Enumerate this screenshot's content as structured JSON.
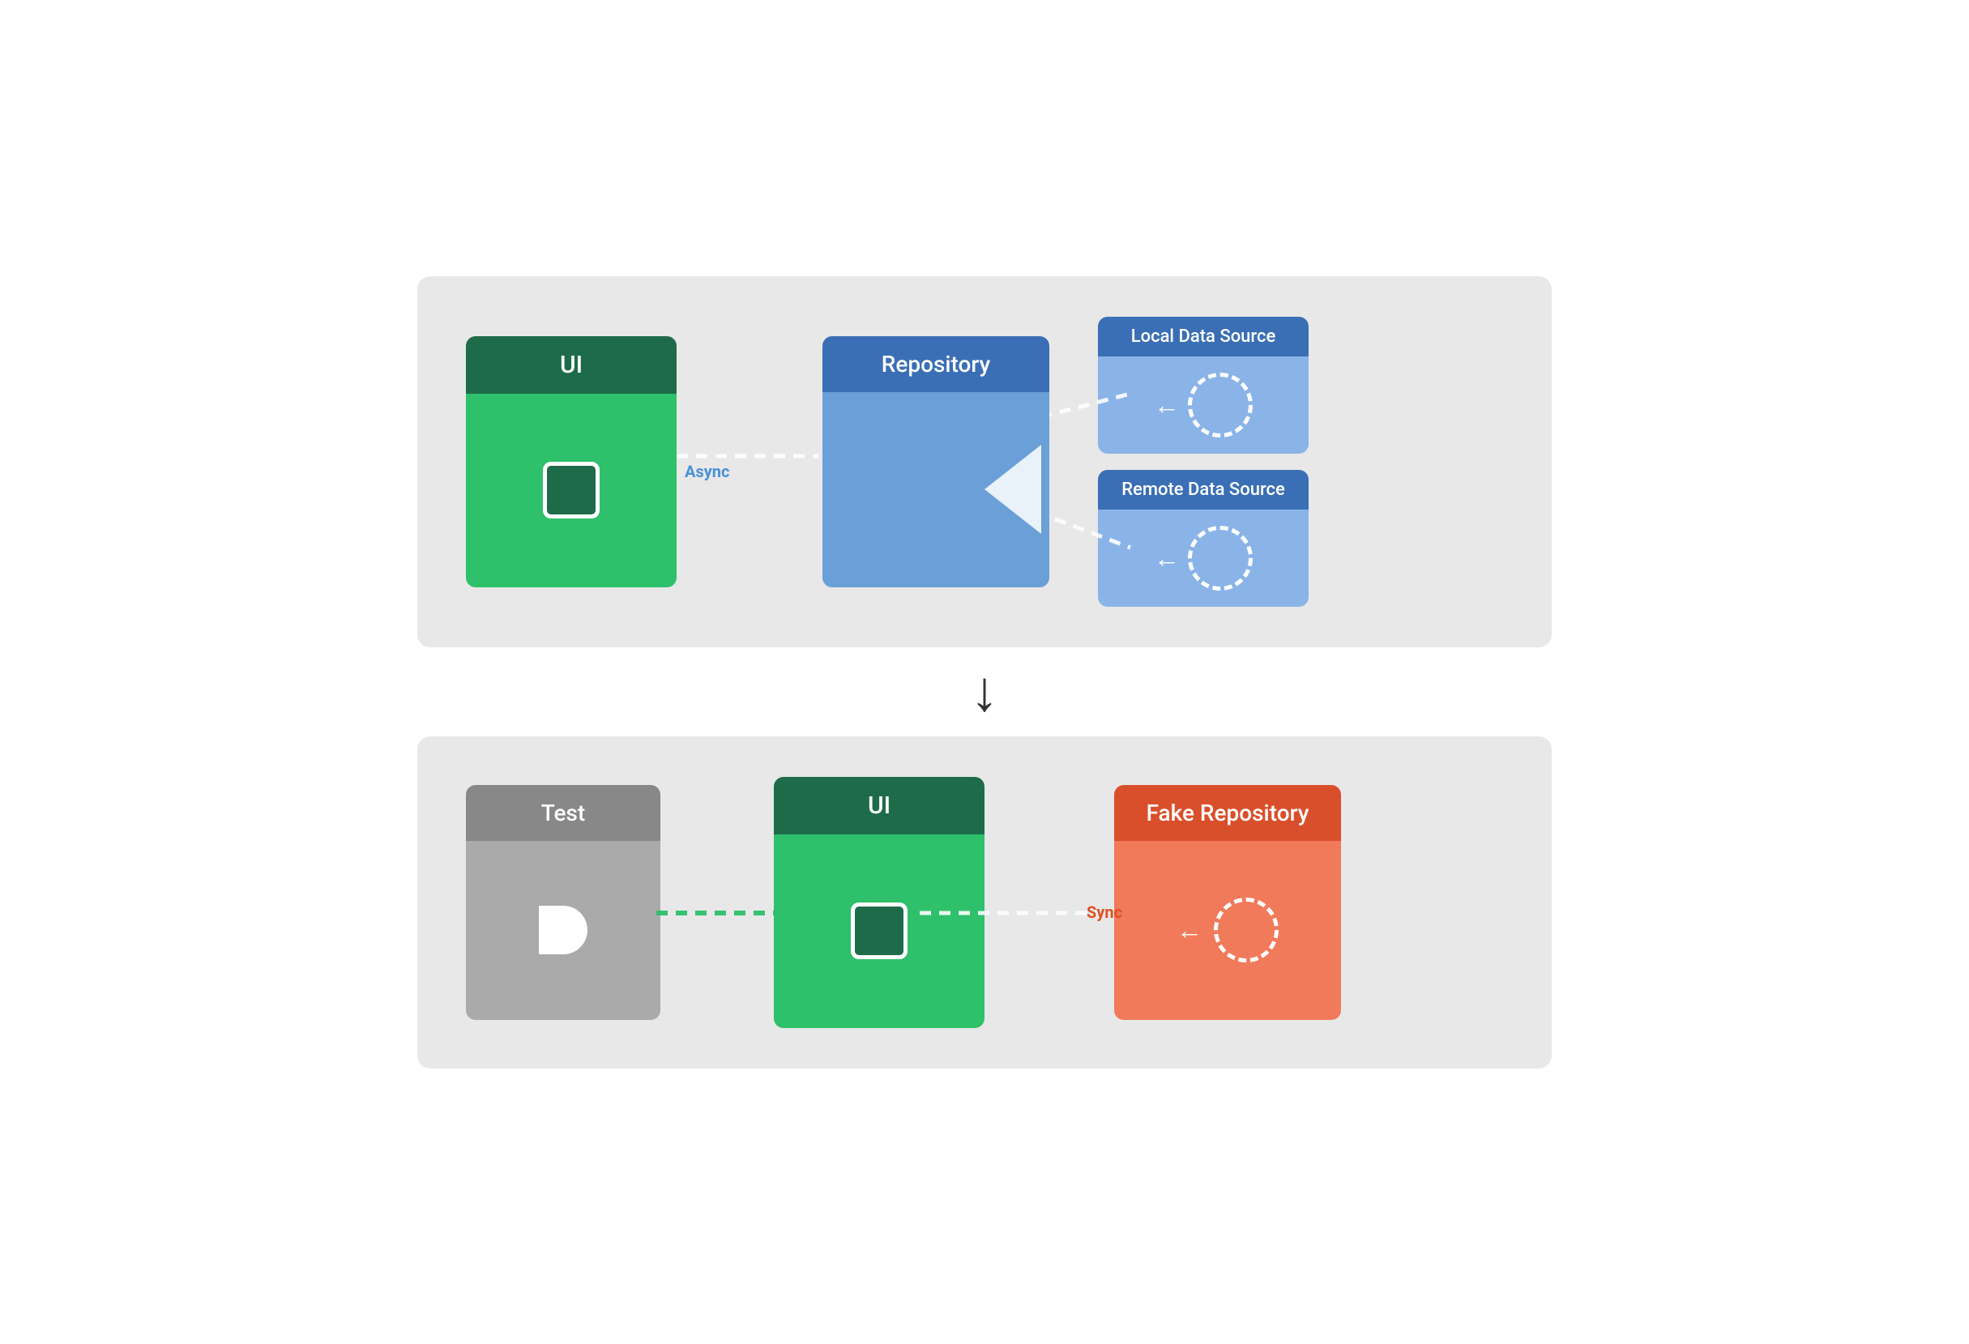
{
  "top_diagram": {
    "ui_label": "UI",
    "async_label": "Async",
    "repo_label": "Repository",
    "local_source_label": "Local Data Source",
    "remote_source_label": "Remote Data Source"
  },
  "bottom_diagram": {
    "test_label": "Test",
    "ui_label": "UI",
    "sync_label": "Sync",
    "fake_repo_label": "Fake Repository"
  },
  "down_arrow": "↓",
  "colors": {
    "ui_header": "#1e6b4a",
    "ui_body": "#2ec06a",
    "repo_header": "#3a6fb5",
    "repo_body": "#6a9fd8",
    "source_header": "#3a6fb5",
    "source_body": "#8ab4e8",
    "test_header": "#888888",
    "test_body": "#aaaaaa",
    "fake_header": "#d94f2b",
    "fake_body": "#f07a5a",
    "diagram_bg": "#e8e8e8"
  }
}
